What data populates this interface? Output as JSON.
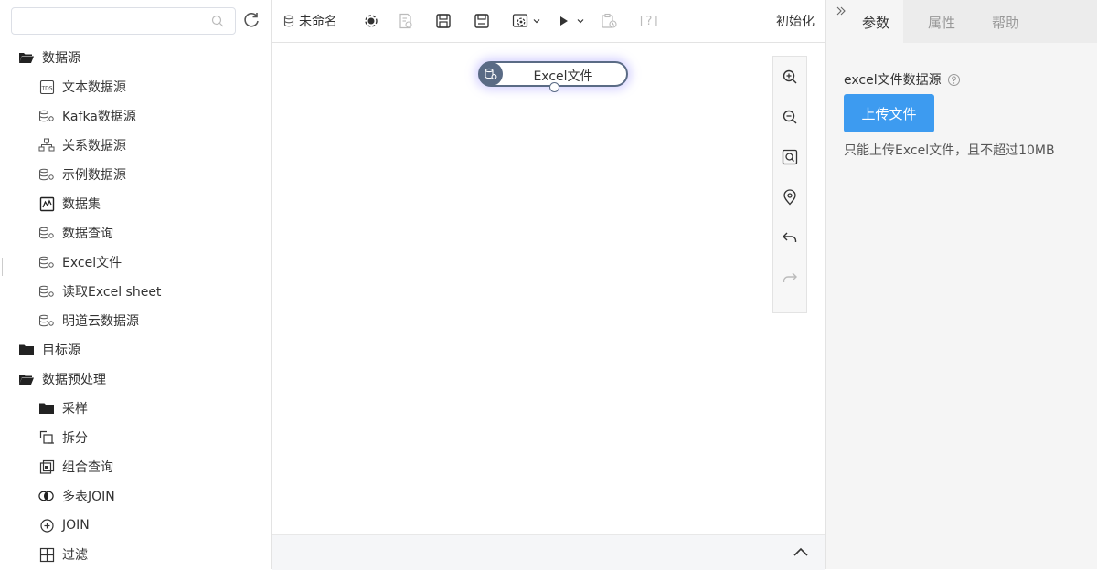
{
  "sidebar": {
    "search": {
      "placeholder": "",
      "value": ""
    },
    "tree": [
      {
        "type": "folder",
        "icon": "folder-open-icon",
        "label": "数据源"
      },
      {
        "type": "child",
        "icon": "text-datasource-icon",
        "label": "文本数据源"
      },
      {
        "type": "child",
        "icon": "database-gear-icon",
        "label": "Kafka数据源"
      },
      {
        "type": "child",
        "icon": "relational-db-icon",
        "label": "关系数据源"
      },
      {
        "type": "child",
        "icon": "database-gear-icon",
        "label": "示例数据源"
      },
      {
        "type": "child",
        "icon": "dataset-icon",
        "label": "数据集"
      },
      {
        "type": "child",
        "icon": "database-gear-icon",
        "label": "数据查询"
      },
      {
        "type": "child",
        "icon": "database-gear-icon",
        "label": "Excel文件"
      },
      {
        "type": "child",
        "icon": "database-gear-icon",
        "label": "读取Excel sheet"
      },
      {
        "type": "child",
        "icon": "database-gear-icon",
        "label": "明道云数据源"
      },
      {
        "type": "folder",
        "icon": "folder-closed-icon",
        "label": "目标源"
      },
      {
        "type": "folder",
        "icon": "folder-open-icon",
        "label": "数据预处理"
      },
      {
        "type": "child",
        "icon": "folder-closed-icon",
        "label": "采样"
      },
      {
        "type": "child",
        "icon": "split-icon",
        "label": "拆分"
      },
      {
        "type": "child",
        "icon": "combine-query-icon",
        "label": "组合查询"
      },
      {
        "type": "child",
        "icon": "multi-join-icon",
        "label": "多表JOIN"
      },
      {
        "type": "child",
        "icon": "join-plus-icon",
        "label": "JOIN"
      },
      {
        "type": "child",
        "icon": "filter-icon",
        "label": "过滤"
      }
    ]
  },
  "toolbar": {
    "title": "未命名",
    "help": "[?]",
    "init": "初始化"
  },
  "canvas": {
    "node": {
      "label": "Excel文件"
    }
  },
  "right_panel": {
    "tabs": [
      "参数",
      "属性",
      "帮助"
    ],
    "active_tab": "参数",
    "field_label": "excel文件数据源",
    "upload_button": "上传文件",
    "upload_tip": "只能上传Excel文件，且不超过10MB"
  },
  "colors": {
    "accent": "#3d9bf0",
    "node_border": "#5a6b85",
    "node_glow": "#9b8cff"
  }
}
